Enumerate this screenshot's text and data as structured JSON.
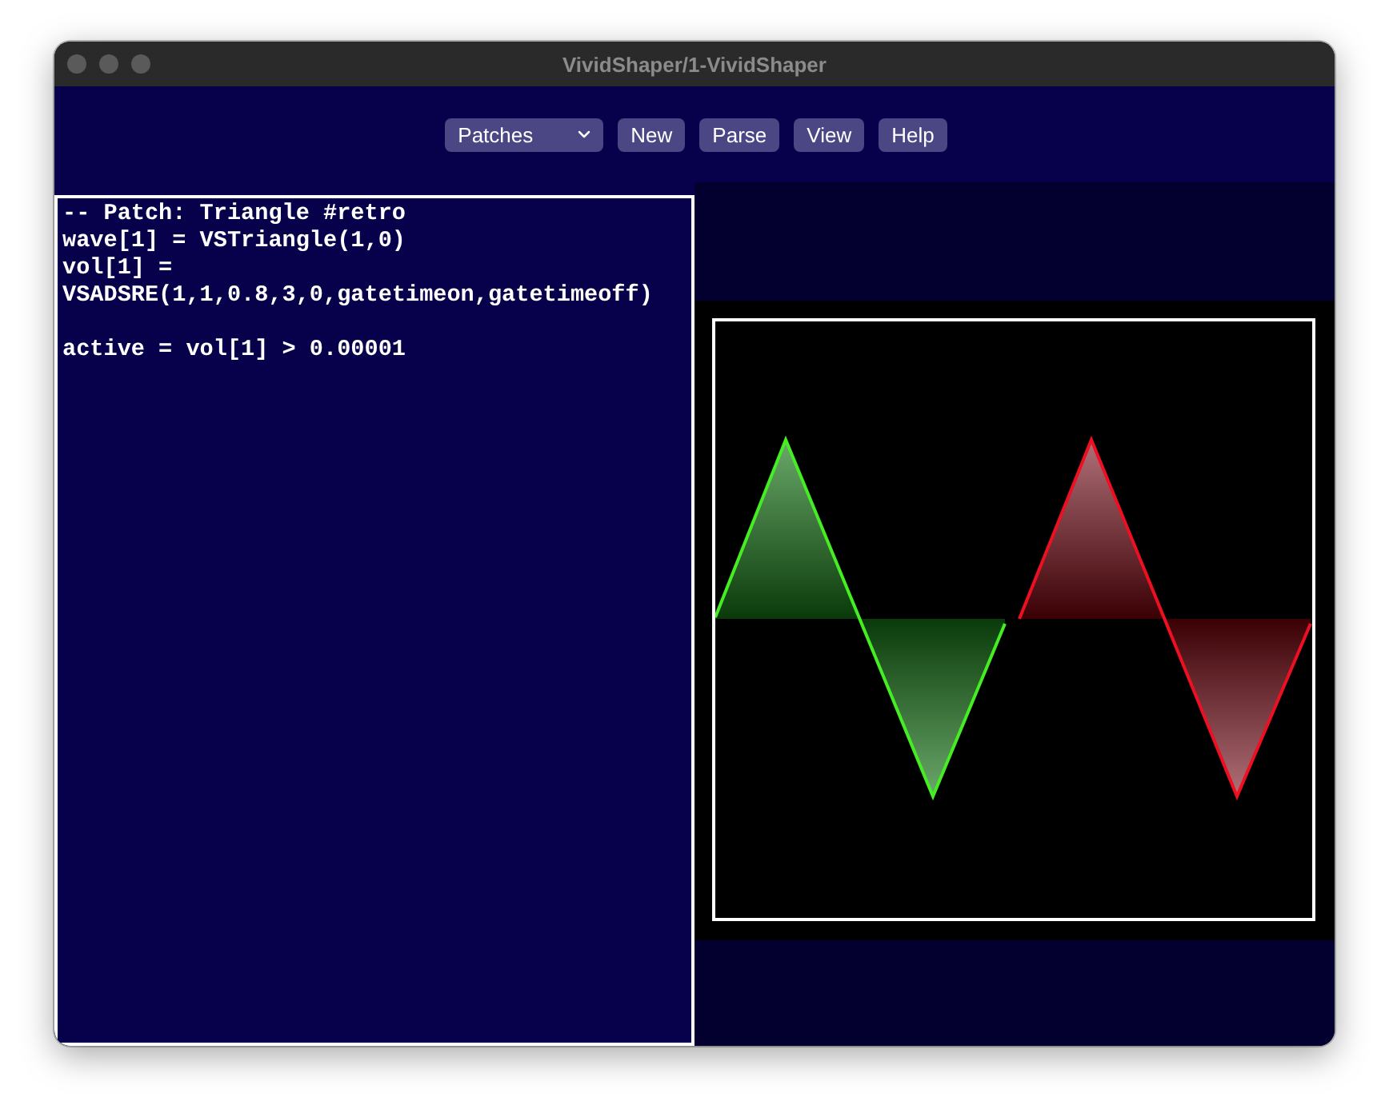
{
  "window": {
    "title": "VividShaper/1-VividShaper"
  },
  "toolbar": [
    {
      "kind": "select",
      "label": "Patches"
    },
    {
      "kind": "button",
      "label": "New"
    },
    {
      "kind": "button",
      "label": "Parse"
    },
    {
      "kind": "button",
      "label": "View"
    },
    {
      "kind": "button",
      "label": "Help"
    }
  ],
  "editor": {
    "text": "-- Patch: Triangle #retro\nwave[1] = VSTriangle(1,0)\nvol[1] =\nVSADSRE(1,1,0.8,3,0,gatetimeon,gatetimeoff)\n\nactive = vol[1] > 0.00001"
  }
}
